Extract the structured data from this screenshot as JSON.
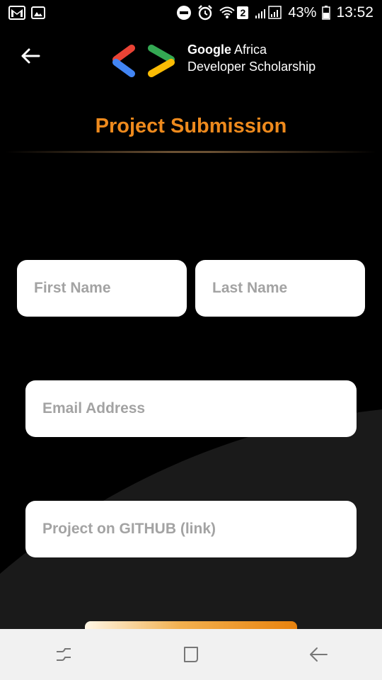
{
  "status_bar": {
    "battery_percent": "43%",
    "time": "13:52",
    "sim_badge": "2",
    "icons": [
      "gmail-icon",
      "gallery-icon",
      "do-not-disturb-icon",
      "alarm-icon",
      "wifi-icon",
      "signal-icon",
      "battery-icon"
    ]
  },
  "header": {
    "back_icon": "arrow-left-icon",
    "brand_line1_bold": "Google",
    "brand_line1_rest": " Africa",
    "brand_line2": "Developer Scholarship"
  },
  "page": {
    "title": "Project Submission"
  },
  "form": {
    "first_name_placeholder": "First Name",
    "last_name_placeholder": "Last Name",
    "email_placeholder": "Email Address",
    "github_placeholder": "Project on GITHUB (link)"
  },
  "nav_bar": {
    "icons": [
      "recents-icon",
      "home-icon",
      "back-icon"
    ]
  },
  "colors": {
    "accent": "#ee8a1d",
    "background": "#000000",
    "curve": "#1a1a1a",
    "field_bg": "#ffffff",
    "placeholder": "#a3a3a3",
    "nav_bg": "#f1f1f1"
  }
}
